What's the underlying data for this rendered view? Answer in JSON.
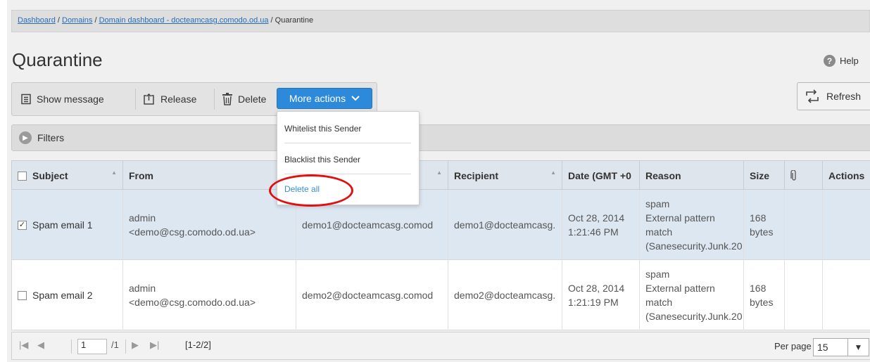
{
  "breadcrumb": {
    "items": [
      "Dashboard",
      "Domains",
      "Domain dashboard - docteamcasg.comodo.od.ua"
    ],
    "current": "Quarantine",
    "separator": " / "
  },
  "page_title": "Quarantine",
  "help_label": "Help",
  "toolbar": {
    "show_message": "Show message",
    "release": "Release",
    "delete": "Delete",
    "more_actions": "More actions"
  },
  "refresh_label": "Refresh",
  "filters_label": "Filters",
  "more_actions_menu": {
    "items": [
      "Whitelist this Sender",
      "Blacklist this Sender",
      "Delete all"
    ]
  },
  "table": {
    "headers": {
      "subject": "Subject",
      "from": "From",
      "recipient": "Recipient",
      "date": "Date (GMT +0",
      "reason": "Reason",
      "size": "Size",
      "actions": "Actions"
    },
    "rows": [
      {
        "checked": true,
        "subject": "Spam email 1",
        "from_name": "admin",
        "from_email": "<demo@csg.comodo.od.ua>",
        "to": "demo1@docteamcasg.comod",
        "recipient": "demo1@docteamcasg.",
        "date_line1": "Oct 28, 2014",
        "date_line2": "1:21:46 PM",
        "reason_lines": [
          "spam",
          "External pattern",
          "match",
          "(Sanesecurity.Junk.20"
        ],
        "size_value": "168",
        "size_unit": "bytes"
      },
      {
        "checked": false,
        "subject": "Spam email 2",
        "from_name": "admin",
        "from_email": "<demo@csg.comodo.od.ua>",
        "to": "demo2@docteamcasg.comod",
        "recipient": "demo2@docteamcasg.",
        "date_line1": "Oct 28, 2014",
        "date_line2": "1:21:19 PM",
        "reason_lines": [
          "spam",
          "External pattern",
          "match",
          "(Sanesecurity.Junk.20"
        ],
        "size_value": "168",
        "size_unit": "bytes"
      }
    ]
  },
  "pager": {
    "page": "1",
    "total": "/1",
    "range": "[1-2/2]",
    "per_page_label": "Per page",
    "per_page_value": "15"
  },
  "colors": {
    "accent": "#2d89d9",
    "link": "#2a6db4",
    "highlight_oval": "#e01010",
    "selected_row": "#dde7f1"
  }
}
